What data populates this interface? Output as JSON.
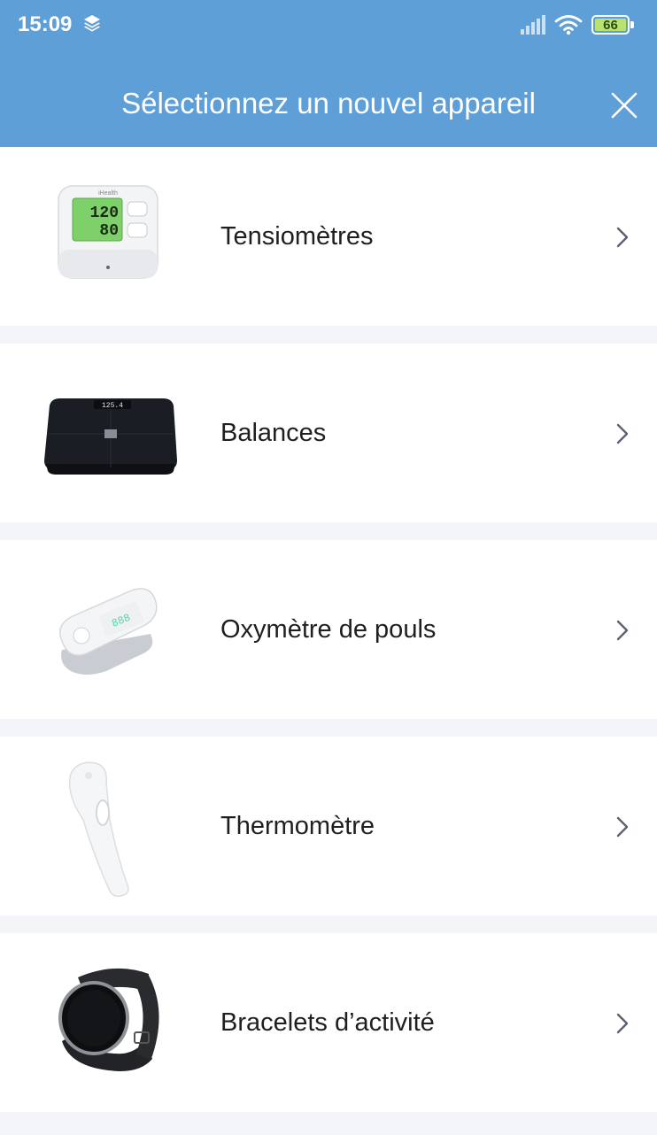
{
  "status_bar": {
    "time": "15:09",
    "battery": "66",
    "icons": [
      "layers-icon",
      "signal-icon",
      "wifi-icon",
      "battery-icon"
    ]
  },
  "header": {
    "title": "Sélectionnez un nouvel appareil",
    "close_icon": "close-icon"
  },
  "devices": [
    {
      "label": "Tensiomètres",
      "image": "blood-pressure-monitor",
      "bp_sys": "120",
      "bp_dia": "80",
      "brand": "iHealth"
    },
    {
      "label": "Balances",
      "image": "smart-scale",
      "display": "125.4"
    },
    {
      "label": "Oxymètre de pouls",
      "image": "pulse-oximeter"
    },
    {
      "label": "Thermomètre",
      "image": "thermometer"
    },
    {
      "label": "Bracelets d’activité",
      "image": "activity-bracelet"
    }
  ],
  "colors": {
    "header": "#5f9fd8",
    "background": "#f4f5f9",
    "battery_fill": "#b9e36e",
    "chevron": "#5b6270"
  }
}
